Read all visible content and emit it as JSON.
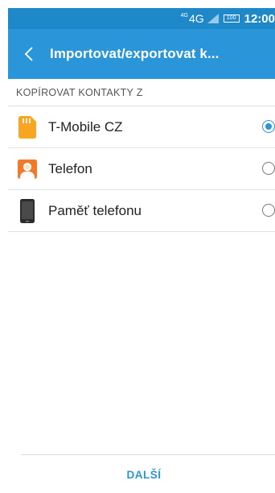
{
  "status_bar": {
    "network_superscript": "4G",
    "network_type": "4G",
    "battery_level": "100",
    "time": "12:00"
  },
  "app_bar": {
    "title": "Importovat/exportovat k..."
  },
  "section": {
    "header": "KOPÍROVAT KONTAKTY Z"
  },
  "options": [
    {
      "label": "T-Mobile CZ",
      "icon": "sim-card-icon",
      "selected": true
    },
    {
      "label": "Telefon",
      "icon": "contact-icon",
      "selected": false
    },
    {
      "label": "Paměť telefonu",
      "icon": "phone-icon",
      "selected": false
    }
  ],
  "footer": {
    "next_label": "DALŠÍ"
  },
  "colors": {
    "status_bar": "#1e88c8",
    "app_bar": "#2a95d8",
    "accent": "#2a95d8",
    "sim_icon": "#f6a623",
    "contact_icon": "#f07a2a"
  }
}
